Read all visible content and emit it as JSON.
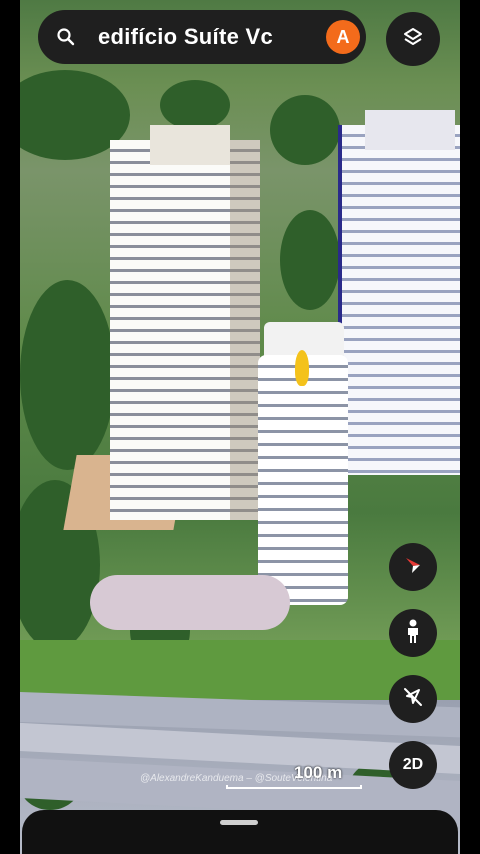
{
  "search": {
    "query": "edifício Suíte Vc",
    "icon": "search-icon"
  },
  "account": {
    "initial": "A",
    "color": "#f36b1b"
  },
  "layers": {
    "icon": "layers-icon"
  },
  "controls": {
    "compass_icon": "compass-icon",
    "street_view_icon": "pegman-icon",
    "navigation_icon": "navigation-off-icon",
    "view_mode_label": "2D"
  },
  "scale": {
    "label": "100 m"
  },
  "watermark": {
    "text": "@AlexandreKanduema – @SouteVelentina"
  }
}
